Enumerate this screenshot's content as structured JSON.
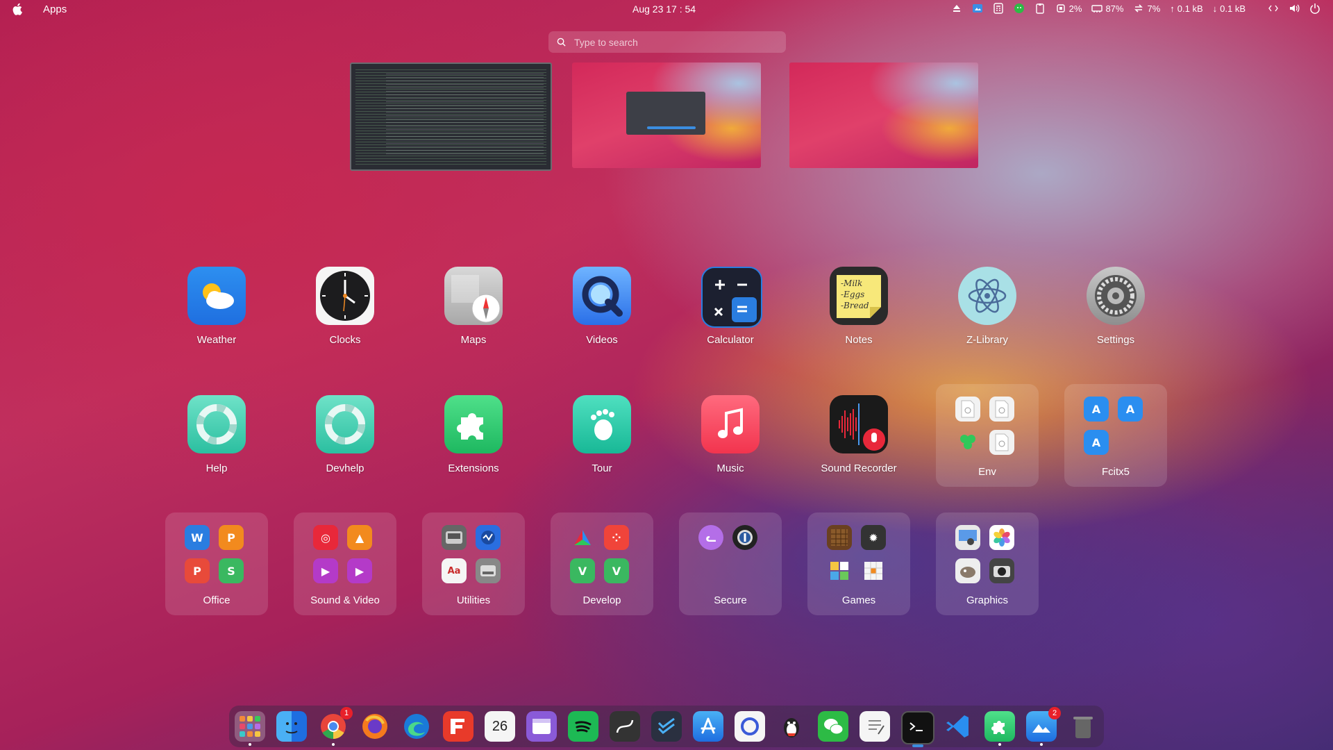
{
  "topbar": {
    "app_name": "Apps",
    "datetime": "Aug 23  17 : 54",
    "cpu": "2%",
    "memory": "87%",
    "swap": "7%",
    "upload": "0.1 kB",
    "download": "0.1 kB"
  },
  "search": {
    "placeholder": "Type to search"
  },
  "apps_row1": [
    {
      "label": "Weather",
      "icon": "weather-icon"
    },
    {
      "label": "Clocks",
      "icon": "clock-icon"
    },
    {
      "label": "Maps",
      "icon": "compass-icon"
    },
    {
      "label": "Videos",
      "icon": "quicktime-icon"
    },
    {
      "label": "Calculator",
      "icon": "calculator-icon"
    },
    {
      "label": "Notes",
      "icon": "note-icon"
    },
    {
      "label": "Z-Library",
      "icon": "atom-icon"
    },
    {
      "label": "Settings",
      "icon": "gear-icon"
    }
  ],
  "apps_row2": [
    {
      "label": "Help",
      "icon": "lifebuoy-icon"
    },
    {
      "label": "Devhelp",
      "icon": "lifebuoy-icon"
    },
    {
      "label": "Extensions",
      "icon": "puzzle-icon"
    },
    {
      "label": "Tour",
      "icon": "footprint-icon"
    },
    {
      "label": "Music",
      "icon": "music-note-icon"
    },
    {
      "label": "Sound Recorder",
      "icon": "waveform-icon"
    }
  ],
  "folders": {
    "env": "Env",
    "fcitx5": "Fcitx5",
    "office": "Office",
    "sound_video": "Sound & Video",
    "utilities": "Utilities",
    "develop": "Develop",
    "secure": "Secure",
    "games": "Games",
    "graphics": "Graphics"
  },
  "dock": {
    "chrome_badge": "1",
    "calendar_day": "26",
    "spotify_badge": "2"
  },
  "colors": {
    "accent": "#3b8de0",
    "badge": "#e8202a"
  }
}
